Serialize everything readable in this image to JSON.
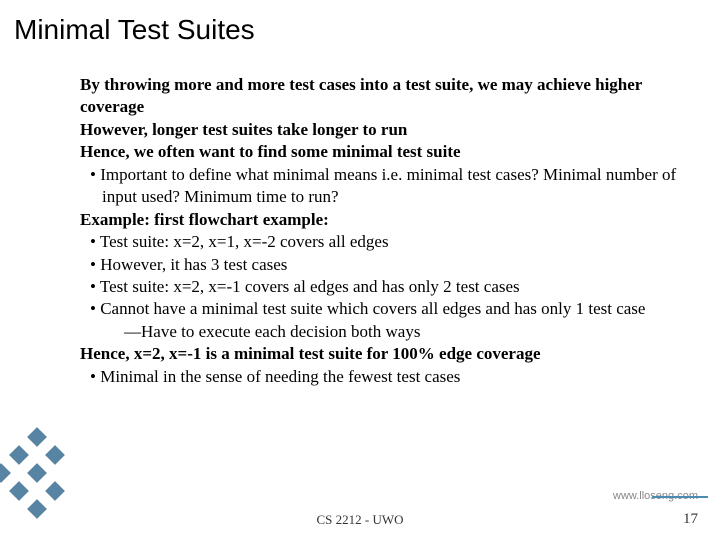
{
  "title": "Minimal Test Suites",
  "body": {
    "p1": "By throwing more and more test cases into a test suite, we may achieve higher coverage",
    "p2": "However, longer test suites take longer to run",
    "p3": "Hence, we often want to find some minimal test suite",
    "b1": "Important to define what minimal means i.e. minimal test cases? Minimal number of input used? Minimum time to run?",
    "p4": "Example: first flowchart example:",
    "b2": "Test suite: x=2, x=1, x=-2 covers all edges",
    "b3": "However, it has 3 test cases",
    "b4": "Test suite: x=2, x=-1 covers al edges and has only 2 test cases",
    "b5": "Cannot have a minimal test suite which covers all edges and has only 1 test case",
    "b5a": "—Have to execute each decision both ways",
    "p5": "Hence, x=2, x=-1 is a minimal test suite for 100% edge coverage",
    "b6": "Minimal in the sense of needing the fewest test cases"
  },
  "footer": {
    "course": "CS 2212 - UWO",
    "page": "17",
    "watermark": "www.lloseng.com"
  }
}
